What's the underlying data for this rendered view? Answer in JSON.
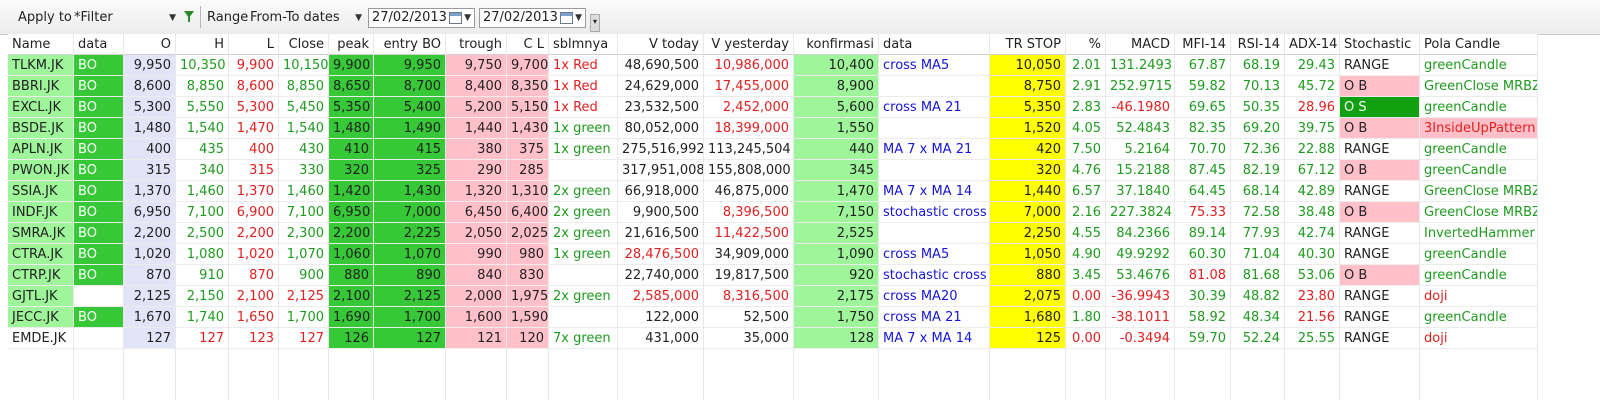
{
  "toolbar": {
    "apply_to_label": "Apply to",
    "filter_value": "*Filter",
    "range_label": "Range",
    "range_value": "From-To dates",
    "date_from": "27/02/2013",
    "date_to": "27/02/2013"
  },
  "colors": {
    "light_green": "#9ef59a",
    "bright_green": "#37c837",
    "pink": "#ffc0c9",
    "yellow": "#ffff00",
    "lavender": "#e4e4f8",
    "text_green": "#1f9b1f",
    "text_red": "#e02020",
    "text_blue": "#1515d8"
  },
  "columns": [
    {
      "key": "name",
      "label": "Name",
      "w": 66,
      "align": "l"
    },
    {
      "key": "data",
      "label": "data",
      "w": 50,
      "align": "l"
    },
    {
      "key": "o",
      "label": "O",
      "w": 52,
      "align": "r"
    },
    {
      "key": "h",
      "label": "H",
      "w": 53,
      "align": "r"
    },
    {
      "key": "l",
      "label": "L",
      "w": 50,
      "align": "r"
    },
    {
      "key": "close",
      "label": "Close",
      "w": 50,
      "align": "r"
    },
    {
      "key": "peak",
      "label": "peak",
      "w": 45,
      "align": "r"
    },
    {
      "key": "entry",
      "label": "entry BO",
      "w": 72,
      "align": "r"
    },
    {
      "key": "trough",
      "label": "trough",
      "w": 61,
      "align": "r"
    },
    {
      "key": "cl",
      "label": "C L",
      "w": 42,
      "align": "r"
    },
    {
      "key": "sblmnya",
      "label": "sblmnya",
      "w": 69,
      "align": "l"
    },
    {
      "key": "vtoday",
      "label": "V today",
      "w": 86,
      "align": "r"
    },
    {
      "key": "vyest",
      "label": "V yesterday",
      "w": 90,
      "align": "r"
    },
    {
      "key": "konf",
      "label": "konfirmasi",
      "w": 85,
      "align": "r"
    },
    {
      "key": "data2",
      "label": "data",
      "w": 111,
      "align": "l"
    },
    {
      "key": "trstop",
      "label": "TR STOP",
      "w": 76,
      "align": "r"
    },
    {
      "key": "pct",
      "label": "%",
      "w": 40,
      "align": "r"
    },
    {
      "key": "macd",
      "label": "MACD",
      "w": 69,
      "align": "r"
    },
    {
      "key": "mfi",
      "label": "MFI-14",
      "w": 56,
      "align": "r"
    },
    {
      "key": "rsi",
      "label": "RSI-14",
      "w": 54,
      "align": "r"
    },
    {
      "key": "adx",
      "label": "ADX-14",
      "w": 55,
      "align": "r"
    },
    {
      "key": "stoch",
      "label": "Stochastic",
      "w": 80,
      "align": "l"
    },
    {
      "key": "pola",
      "label": "Pola Candle",
      "w": 118,
      "align": "l"
    }
  ],
  "rows": [
    {
      "name": "TLKM.JK",
      "data": "BO",
      "o": "9,950",
      "h": "10,350",
      "l": "9,900",
      "close": "10,150",
      "peak": "9,900",
      "entry": "9,950",
      "trough": "9,750",
      "cl": "9,700",
      "sblmnya": "1x Red",
      "vtoday": "48,690,500",
      "vyest": "10,986,000",
      "konf": "10,400",
      "data2": "cross MA5",
      "trstop": "10,050",
      "pct": "2.01",
      "macd": "131.2493",
      "mfi": "67.87",
      "rsi": "68.19",
      "adx": "29.43",
      "stoch": "RANGE",
      "pola": "greenCandle",
      "c": {
        "h": "green",
        "l": "red",
        "close": "green",
        "sblmnya": "red",
        "vyest": "red",
        "pct": "green",
        "macd": "green",
        "mfi": "green",
        "rsi": "green",
        "adx": "green",
        "pola": "green"
      }
    },
    {
      "name": "BBRI.JK",
      "data": "BO",
      "o": "8,600",
      "h": "8,850",
      "l": "8,600",
      "close": "8,850",
      "peak": "8,650",
      "entry": "8,700",
      "trough": "8,400",
      "cl": "8,350",
      "sblmnya": "1x Red",
      "vtoday": "24,629,000",
      "vyest": "17,455,000",
      "konf": "8,900",
      "data2": "",
      "trstop": "8,750",
      "pct": "2.91",
      "macd": "252.9715",
      "mfi": "59.82",
      "rsi": "70.13",
      "adx": "45.72",
      "stoch": "O B",
      "pola": "GreenClose MRBZ",
      "c": {
        "h": "green",
        "l": "red",
        "close": "green",
        "sblmnya": "red",
        "vyest": "red",
        "pct": "green",
        "macd": "green",
        "mfi": "green",
        "rsi": "green",
        "adx": "green",
        "pola": "green"
      },
      "stochPink": true
    },
    {
      "name": "EXCL.JK",
      "data": "BO",
      "o": "5,300",
      "h": "5,550",
      "l": "5,300",
      "close": "5,450",
      "peak": "5,350",
      "entry": "5,400",
      "trough": "5,200",
      "cl": "5,150",
      "sblmnya": "1x Red",
      "vtoday": "23,532,500",
      "vyest": "2,452,000",
      "konf": "5,600",
      "data2": "cross MA 21",
      "trstop": "5,350",
      "pct": "2.83",
      "macd": "-46.1980",
      "mfi": "69.65",
      "rsi": "50.35",
      "adx": "28.96",
      "stoch": "O S",
      "pola": "greenCandle",
      "c": {
        "h": "green",
        "l": "red",
        "close": "green",
        "sblmnya": "red",
        "vyest": "red",
        "pct": "green",
        "macd": "red",
        "mfi": "green",
        "rsi": "green",
        "adx": "red",
        "pola": "green"
      },
      "stochGreen": true
    },
    {
      "name": "BSDE.JK",
      "data": "BO",
      "o": "1,480",
      "h": "1,540",
      "l": "1,470",
      "close": "1,540",
      "peak": "1,480",
      "entry": "1,490",
      "trough": "1,440",
      "cl": "1,430",
      "sblmnya": "1x green",
      "vtoday": "80,052,000",
      "vyest": "18,399,000",
      "konf": "1,550",
      "data2": "",
      "trstop": "1,520",
      "pct": "4.05",
      "macd": "52.4843",
      "mfi": "82.35",
      "rsi": "69.20",
      "adx": "39.75",
      "stoch": "O B",
      "pola": "3InsideUpPattern",
      "c": {
        "h": "green",
        "l": "red",
        "close": "green",
        "sblmnya": "green",
        "vyest": "red",
        "pct": "green",
        "macd": "green",
        "mfi": "green",
        "rsi": "green",
        "adx": "green",
        "pola": "red"
      },
      "stochPink": true,
      "polaPink": true
    },
    {
      "name": "APLN.JK",
      "data": "BO",
      "o": "400",
      "h": "435",
      "l": "400",
      "close": "430",
      "peak": "410",
      "entry": "415",
      "trough": "380",
      "cl": "375",
      "sblmnya": "1x green",
      "vtoday": "275,516,992",
      "vyest": "113,245,504",
      "konf": "440",
      "data2": "MA 7 x MA 21",
      "trstop": "420",
      "pct": "7.50",
      "macd": "5.2164",
      "mfi": "70.70",
      "rsi": "72.36",
      "adx": "22.88",
      "stoch": "RANGE",
      "pola": "greenCandle",
      "c": {
        "h": "green",
        "l": "red",
        "close": "green",
        "sblmnya": "green",
        "vyest": "black",
        "pct": "green",
        "macd": "green",
        "mfi": "green",
        "rsi": "green",
        "adx": "green",
        "pola": "green"
      }
    },
    {
      "name": "PWON.JK",
      "data": "BO",
      "o": "315",
      "h": "340",
      "l": "315",
      "close": "330",
      "peak": "320",
      "entry": "325",
      "trough": "290",
      "cl": "285",
      "sblmnya": "",
      "vtoday": "317,951,008",
      "vyest": "155,808,000",
      "konf": "345",
      "data2": "",
      "trstop": "320",
      "pct": "4.76",
      "macd": "15.2188",
      "mfi": "87.45",
      "rsi": "82.19",
      "adx": "67.12",
      "stoch": "O B",
      "pola": "greenCandle",
      "c": {
        "h": "green",
        "l": "red",
        "close": "green",
        "sblmnya": "green",
        "vyest": "black",
        "pct": "green",
        "macd": "green",
        "mfi": "green",
        "rsi": "green",
        "adx": "green",
        "pola": "green"
      },
      "stochPink": true
    },
    {
      "name": "SSIA.JK",
      "data": "BO",
      "o": "1,370",
      "h": "1,460",
      "l": "1,370",
      "close": "1,460",
      "peak": "1,420",
      "entry": "1,430",
      "trough": "1,320",
      "cl": "1,310",
      "sblmnya": "2x green",
      "vtoday": "66,918,000",
      "vyest": "46,875,000",
      "konf": "1,470",
      "data2": "MA 7 x MA 14",
      "trstop": "1,440",
      "pct": "6.57",
      "macd": "37.1840",
      "mfi": "64.45",
      "rsi": "68.14",
      "adx": "42.89",
      "stoch": "RANGE",
      "pola": "GreenClose MRBZ",
      "c": {
        "h": "green",
        "l": "red",
        "close": "green",
        "sblmnya": "green",
        "vyest": "black",
        "pct": "green",
        "macd": "green",
        "mfi": "green",
        "rsi": "green",
        "adx": "green",
        "pola": "green"
      }
    },
    {
      "name": "INDF.JK",
      "data": "BO",
      "o": "6,950",
      "h": "7,100",
      "l": "6,900",
      "close": "7,100",
      "peak": "6,950",
      "entry": "7,000",
      "trough": "6,450",
      "cl": "6,400",
      "sblmnya": "2x green",
      "vtoday": "9,900,500",
      "vyest": "8,396,500",
      "konf": "7,150",
      "data2": "stochastic cross",
      "trstop": "7,000",
      "pct": "2.16",
      "macd": "227.3824",
      "mfi": "75.33",
      "rsi": "72.58",
      "adx": "38.48",
      "stoch": "O B",
      "pola": "GreenClose MRBZ",
      "c": {
        "h": "green",
        "l": "red",
        "close": "green",
        "sblmnya": "green",
        "vyest": "red",
        "pct": "green",
        "macd": "green",
        "mfi": "red",
        "rsi": "green",
        "adx": "green",
        "pola": "green"
      },
      "stochPink": true
    },
    {
      "name": "SMRA.JK",
      "data": "BO",
      "o": "2,200",
      "h": "2,500",
      "l": "2,200",
      "close": "2,300",
      "peak": "2,200",
      "entry": "2,225",
      "trough": "2,050",
      "cl": "2,025",
      "sblmnya": "2x green",
      "vtoday": "21,616,500",
      "vyest": "11,422,500",
      "konf": "2,525",
      "data2": "",
      "trstop": "2,250",
      "pct": "4.55",
      "macd": "84.2366",
      "mfi": "89.14",
      "rsi": "77.93",
      "adx": "42.74",
      "stoch": "RANGE",
      "pola": "InvertedHammer",
      "c": {
        "h": "green",
        "l": "red",
        "close": "green",
        "sblmnya": "green",
        "vyest": "red",
        "pct": "green",
        "macd": "green",
        "mfi": "green",
        "rsi": "green",
        "adx": "green",
        "pola": "green"
      }
    },
    {
      "name": "CTRA.JK",
      "data": "BO",
      "o": "1,020",
      "h": "1,080",
      "l": "1,020",
      "close": "1,070",
      "peak": "1,060",
      "entry": "1,070",
      "trough": "990",
      "cl": "980",
      "sblmnya": "1x green",
      "vtoday": "28,476,500",
      "vyest": "34,909,000",
      "konf": "1,090",
      "data2": "cross MA5",
      "trstop": "1,050",
      "pct": "4.90",
      "macd": "49.9292",
      "mfi": "60.30",
      "rsi": "71.04",
      "adx": "40.30",
      "stoch": "RANGE",
      "pola": "greenCandle",
      "c": {
        "h": "green",
        "l": "red",
        "close": "green",
        "sblmnya": "green",
        "vtoday": "red",
        "vyest": "black",
        "pct": "green",
        "macd": "green",
        "mfi": "green",
        "rsi": "green",
        "adx": "green",
        "pola": "green"
      }
    },
    {
      "name": "CTRP.JK",
      "data": "BO",
      "o": "870",
      "h": "910",
      "l": "870",
      "close": "900",
      "peak": "880",
      "entry": "890",
      "trough": "840",
      "cl": "830",
      "sblmnya": "",
      "vtoday": "22,740,000",
      "vyest": "19,817,500",
      "konf": "920",
      "data2": "stochastic cross",
      "trstop": "880",
      "pct": "3.45",
      "macd": "53.4676",
      "mfi": "81.08",
      "rsi": "81.68",
      "adx": "53.06",
      "stoch": "O B",
      "pola": "greenCandle",
      "c": {
        "h": "green",
        "l": "red",
        "close": "green",
        "sblmnya": "green",
        "vyest": "black",
        "pct": "green",
        "macd": "green",
        "mfi": "red",
        "rsi": "green",
        "adx": "green",
        "pola": "green"
      },
      "stochPink": true
    },
    {
      "name": "GJTL.JK",
      "data": "",
      "o": "2,125",
      "h": "2,150",
      "l": "2,100",
      "close": "2,125",
      "peak": "2,100",
      "entry": "2,125",
      "trough": "2,000",
      "cl": "1,975",
      "sblmnya": "2x green",
      "vtoday": "2,585,000",
      "vyest": "8,316,500",
      "konf": "2,175",
      "data2": "cross MA20",
      "trstop": "2,075",
      "pct": "0.00",
      "macd": "-36.9943",
      "mfi": "30.39",
      "rsi": "48.82",
      "adx": "23.80",
      "stoch": "RANGE",
      "pola": "doji",
      "c": {
        "h": "green",
        "l": "red",
        "close": "red",
        "sblmnya": "green",
        "vtoday": "red",
        "vyest": "red",
        "pct": "red",
        "macd": "red",
        "mfi": "green",
        "rsi": "green",
        "adx": "red",
        "pola": "red"
      },
      "dataWhite": true
    },
    {
      "name": "JECC.JK",
      "data": "BO",
      "o": "1,670",
      "h": "1,740",
      "l": "1,650",
      "close": "1,700",
      "peak": "1,690",
      "entry": "1,700",
      "trough": "1,600",
      "cl": "1,590",
      "sblmnya": "",
      "vtoday": "122,000",
      "vyest": "52,500",
      "konf": "1,750",
      "data2": "cross MA 21",
      "trstop": "1,680",
      "pct": "1.80",
      "macd": "-38.1011",
      "mfi": "58.92",
      "rsi": "48.34",
      "adx": "21.56",
      "stoch": "RANGE",
      "pola": "greenCandle",
      "c": {
        "h": "green",
        "l": "red",
        "close": "green",
        "sblmnya": "green",
        "vyest": "black",
        "pct": "green",
        "macd": "red",
        "mfi": "green",
        "rsi": "green",
        "adx": "red",
        "pola": "green"
      }
    },
    {
      "name": "EMDE.JK",
      "data": "",
      "o": "127",
      "h": "127",
      "l": "123",
      "close": "127",
      "peak": "126",
      "entry": "127",
      "trough": "121",
      "cl": "120",
      "sblmnya": "7x green",
      "vtoday": "431,000",
      "vyest": "35,000",
      "konf": "128",
      "data2": "MA 7 x MA 14",
      "trstop": "125",
      "pct": "0.00",
      "macd": "-0.3494",
      "mfi": "59.70",
      "rsi": "52.24",
      "adx": "25.55",
      "stoch": "RANGE",
      "pola": "doji",
      "c": {
        "h": "red",
        "l": "red",
        "close": "red",
        "sblmnya": "green",
        "vyest": "black",
        "pct": "red",
        "macd": "red",
        "mfi": "green",
        "rsi": "green",
        "adx": "green",
        "pola": "red"
      },
      "dataWhite": true,
      "nameWhite": true
    }
  ]
}
